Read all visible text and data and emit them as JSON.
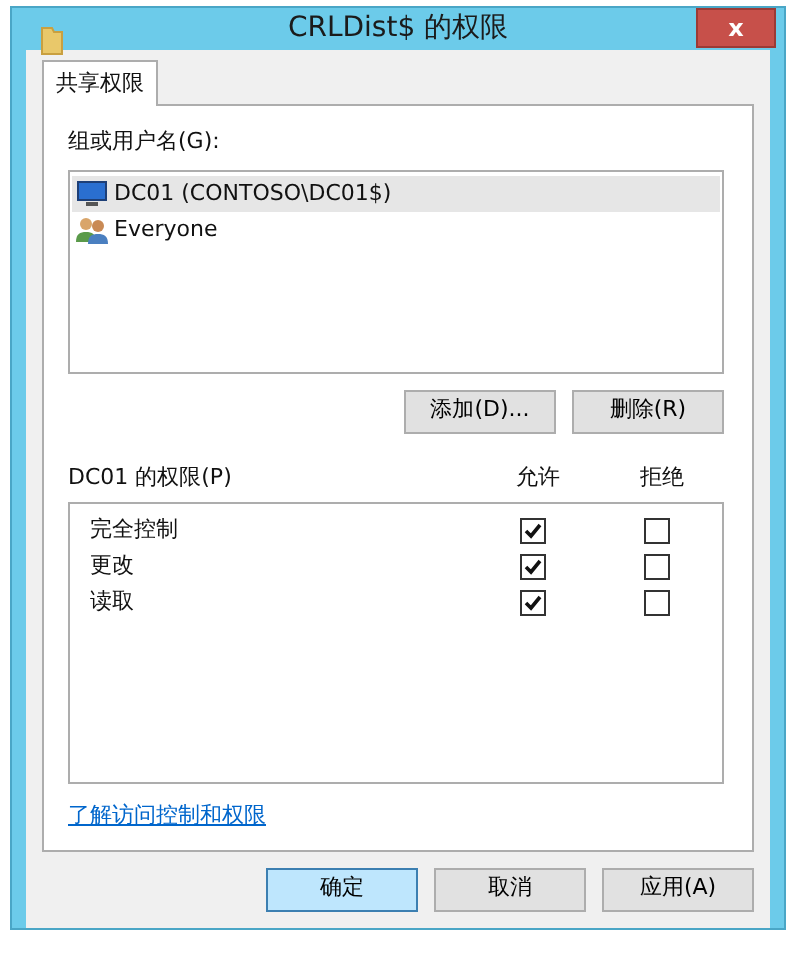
{
  "window": {
    "title": "CRLDist$ 的权限",
    "close": "x"
  },
  "tabs": [
    {
      "label": "共享权限",
      "selected": true
    }
  ],
  "users": {
    "label": "组或用户名(G):",
    "items": [
      {
        "name": "DC01 (CONTOSO\\DC01$)",
        "kind": "computer",
        "selected": true
      },
      {
        "name": "Everyone",
        "kind": "group",
        "selected": false
      }
    ]
  },
  "user_buttons": [
    "添加(D)...",
    "删除(R)"
  ],
  "permissions": {
    "label": "DC01 的权限(P)",
    "columns": [
      "允许",
      "拒绝"
    ],
    "rows": [
      {
        "name": "完全控制",
        "allow": true,
        "deny": false
      },
      {
        "name": "更改",
        "allow": true,
        "deny": false
      },
      {
        "name": "读取",
        "allow": true,
        "deny": false
      }
    ]
  },
  "link": "了解访问控制和权限",
  "buttons": [
    {
      "label": "确定",
      "default": true
    },
    {
      "label": "取消",
      "default": false
    },
    {
      "label": "应用(A)",
      "default": false
    }
  ]
}
